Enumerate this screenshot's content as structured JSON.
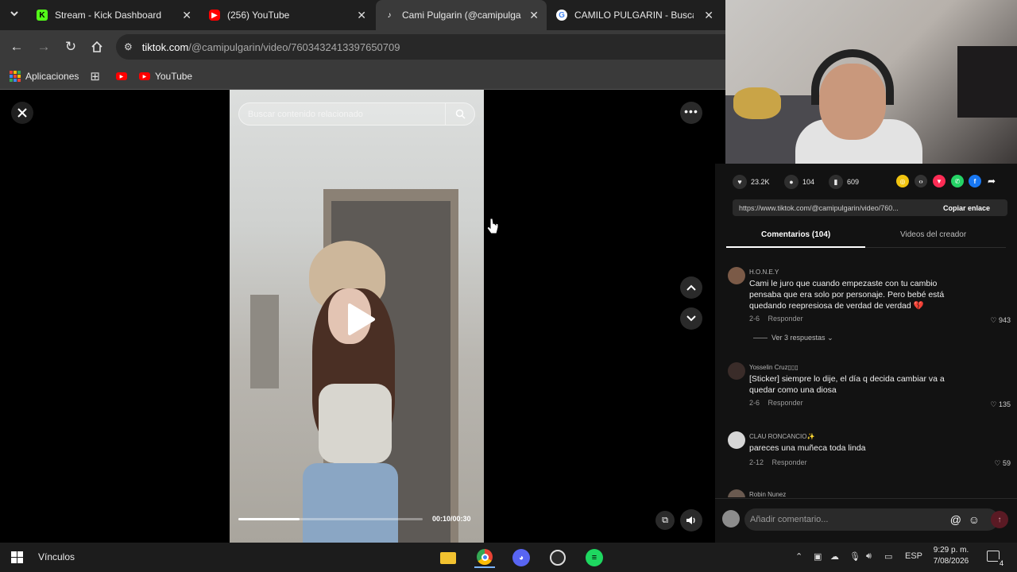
{
  "browser": {
    "tabs": [
      {
        "title": "Stream - Kick Dashboard",
        "favicon": "kick-icon"
      },
      {
        "title": "(256) YouTube",
        "favicon": "youtube-icon"
      },
      {
        "title": "Cami Pulgarin (@camipulgarin",
        "favicon": "tiktok-icon"
      },
      {
        "title": "CAMILO PULGARIN - Buscar co",
        "favicon": "google-icon"
      }
    ],
    "url_host": "tiktok.com",
    "url_path": "/@camipulgarin/video/7603432413397650709",
    "bookmarks": {
      "apps": "Aplicaciones",
      "youtube": "YouTube"
    }
  },
  "player": {
    "search_placeholder": "Buscar contenido relacionado",
    "time": "00:10/00:30",
    "progress": 0.33
  },
  "panel": {
    "likes": "23.2K",
    "comments": "104",
    "saves": "609",
    "link": "https://www.tiktok.com/@camipulgarin/video/760...",
    "copy_label": "Copiar enlace",
    "tab_comments": "Comentarios (104)",
    "tab_creator": "Videos del creador",
    "comment_input_placeholder": "Añadir comentario...",
    "items": [
      {
        "user": "H.O.N.E.Y",
        "text": "Cami le juro que cuando empezaste con tu cambio pensaba que era solo por personaje. Pero bebé está quedando reepresiosa de verdad de verdad 💔",
        "date": "2-6",
        "reply": "Responder",
        "likes": "943",
        "replies": "Ver 3 respuestas"
      },
      {
        "user": "Yosselin Cruz▯▯▯",
        "text": "[Sticker] siempre lo dije, el día q decida cambiar va a quedar como una diosa",
        "date": "2-6",
        "reply": "Responder",
        "likes": "135"
      },
      {
        "user": "CLAU RONCANCIO✨",
        "text": "pareces una muñeca toda linda",
        "date": "2-12",
        "reply": "Responder",
        "likes": "59"
      },
      {
        "user": "Robin Nunez",
        "text": "",
        "date": "",
        "reply": "",
        "likes": ""
      }
    ]
  },
  "taskbar": {
    "vinculos": "Vínculos",
    "lang": "ESP",
    "time": "9:29 p. m.",
    "date": "7/08/2026",
    "notif_count": "4"
  }
}
